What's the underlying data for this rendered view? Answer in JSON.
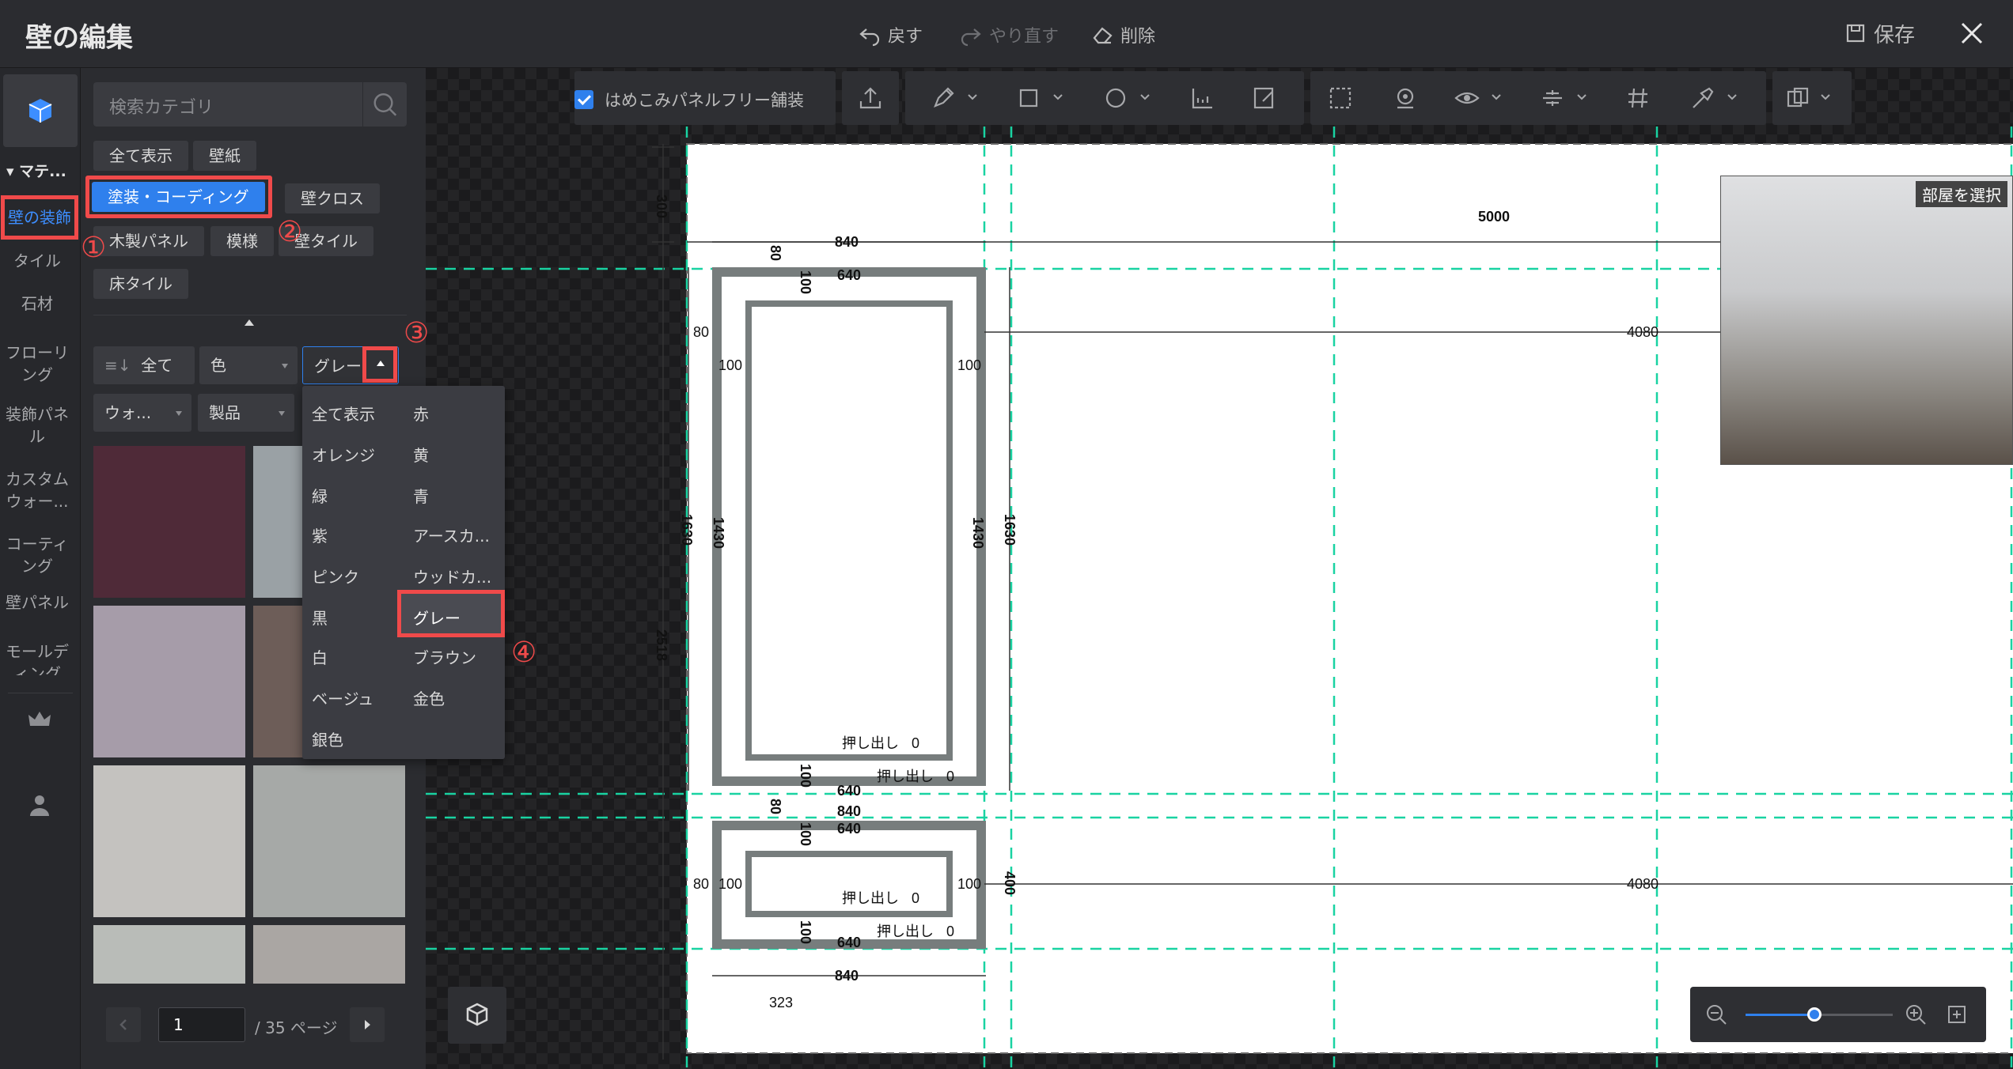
{
  "header": {
    "title": "壁の編集",
    "undo_label": "戻す",
    "redo_label": "やり直す",
    "delete_label": "削除",
    "save_label": "保存"
  },
  "nav": {
    "section_label": "マテ...",
    "items": [
      {
        "label": "壁の装飾",
        "active": true
      },
      {
        "label": "タイル"
      },
      {
        "label": "石材"
      },
      {
        "label": "フローリング"
      },
      {
        "label": "装飾パネル"
      },
      {
        "label": "カスタムウォー..."
      },
      {
        "label": "コーティング"
      },
      {
        "label": "壁パネル"
      },
      {
        "label": "モールディング"
      }
    ]
  },
  "panel": {
    "search_placeholder": "検索カテゴリ",
    "categories": [
      "全て表示",
      "壁紙",
      "塗装・コーディング",
      "壁クロス",
      "木製パネル",
      "模様",
      "壁タイル",
      "床タイル"
    ],
    "selected_category": "塗装・コーディング",
    "filters": {
      "sort_label": "全て",
      "color_label": "色",
      "color_value": "グレー",
      "type_label": "ウォ...",
      "product_label": "製品"
    },
    "swatch_colors": [
      "#4f2a38",
      "#9aa1a5",
      "#a69ca9",
      "#6d5d58",
      "#c4c2bf",
      "#a6a9a7",
      "#b9bcb8",
      "#aaa6a3"
    ],
    "pager": {
      "page": "1",
      "total_text": "/ 35 ページ"
    }
  },
  "color_dropdown": {
    "options": [
      [
        "全て表示",
        "赤"
      ],
      [
        "オレンジ",
        "黄"
      ],
      [
        "緑",
        "青"
      ],
      [
        "紫",
        "アースカ..."
      ],
      [
        "ピンク",
        "ウッドカ..."
      ],
      [
        "黒",
        "グレー"
      ],
      [
        "白",
        "ブラウン"
      ],
      [
        "ベージュ",
        "金色"
      ],
      [
        "銀色",
        ""
      ]
    ],
    "selected": "グレー"
  },
  "steps": [
    "①",
    "②",
    "③",
    "④"
  ],
  "canvas": {
    "toolbar_checkbox_label": "はめこみパネルフリー舗装",
    "room_select_label": "部屋を選択",
    "dimensions": {
      "top_clipped": "5000",
      "total_width": "5000",
      "panel_width": "840",
      "inner_width": "640",
      "frame": "100",
      "gap": "80",
      "top_offset": "300",
      "upper_height_outer": "1630",
      "upper_height_inner": "1430",
      "total_height": "2518",
      "right_offset": "4080",
      "lower_height": "400",
      "bottom_offset": "323",
      "extrude_label": "押し出し",
      "extrude_value": "0"
    }
  },
  "colors": {
    "accent": "#2f80ed",
    "highlight": "#f04a4a",
    "guide": "#19d3a2"
  }
}
